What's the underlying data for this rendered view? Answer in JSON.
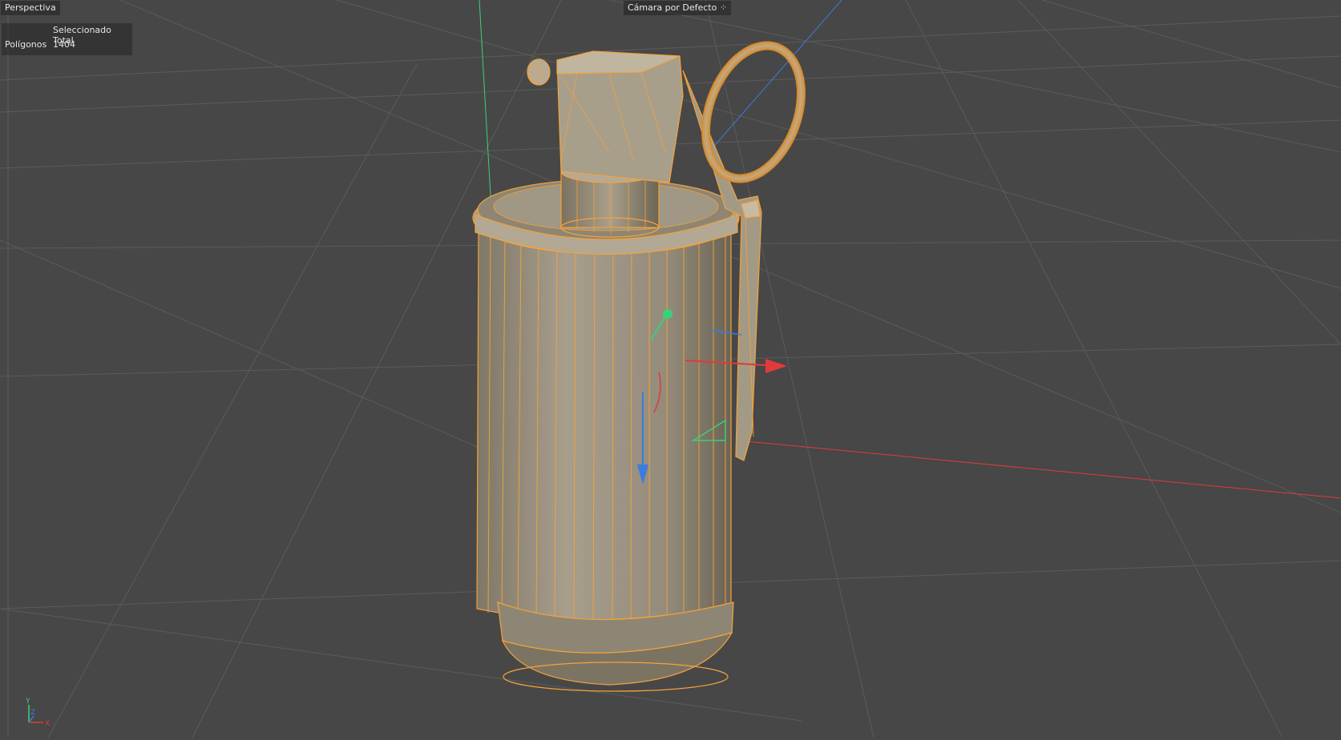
{
  "viewport": {
    "view_name": "Perspectiva",
    "camera": "Cámara por Defecto",
    "camera_icon": "dots-icon"
  },
  "hud": {
    "header": "Seleccionado Total",
    "rows": [
      {
        "label": "Polígonos",
        "value": "1404"
      }
    ]
  },
  "axis_gizmo": {
    "y": "Y",
    "z": "Z",
    "x": "X"
  },
  "colors": {
    "background": "#474747",
    "grid": "#5a5a5a",
    "selection": "#f5a23a",
    "model_fill": "#9b9281",
    "axis_x": "#e03a3a",
    "axis_y": "#3ad07a",
    "axis_z": "#3a7ce0"
  }
}
